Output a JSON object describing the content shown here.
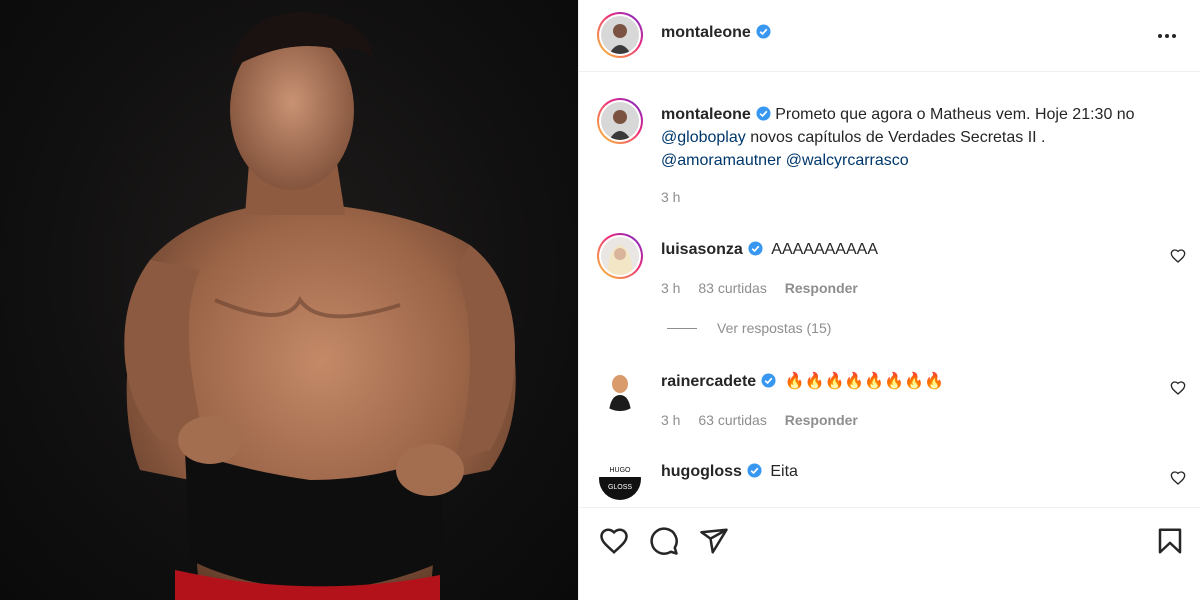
{
  "post": {
    "author": "montaleone",
    "caption": {
      "username": "montaleone",
      "text_1": "Prometo que agora o Matheus vem. Hoje 21:30 no",
      "mention_1": "@globoplay",
      "text_2": " novos capítulos de Verdades Secretas II .",
      "mention_2": "@amoramautner",
      "mention_3": "@walcyrcarrasco",
      "time": "3 h"
    }
  },
  "comments": [
    {
      "username": "luisasonza",
      "text": "AAAAAAAAAA",
      "time": "3 h",
      "likes": "83 curtidas",
      "reply_label": "Responder",
      "view_replies": "Ver respostas (15)"
    },
    {
      "username": "rainercadete",
      "text": "🔥🔥🔥🔥🔥🔥🔥🔥",
      "time": "3 h",
      "likes": "63 curtidas",
      "reply_label": "Responder"
    },
    {
      "username": "hugogloss",
      "text": "Eita",
      "avatar_text_1": "HUGO",
      "avatar_text_2": "GLOSS"
    }
  ],
  "icons": {
    "more": "more-options-icon",
    "verified": "verified-badge-icon",
    "like": "heart-icon",
    "comment": "comment-icon",
    "share": "paper-plane-icon",
    "save": "bookmark-icon"
  },
  "colors": {
    "verified": "#3897f0",
    "mention": "#00376b",
    "meta": "#8e8e8e",
    "divider": "#efefef"
  }
}
